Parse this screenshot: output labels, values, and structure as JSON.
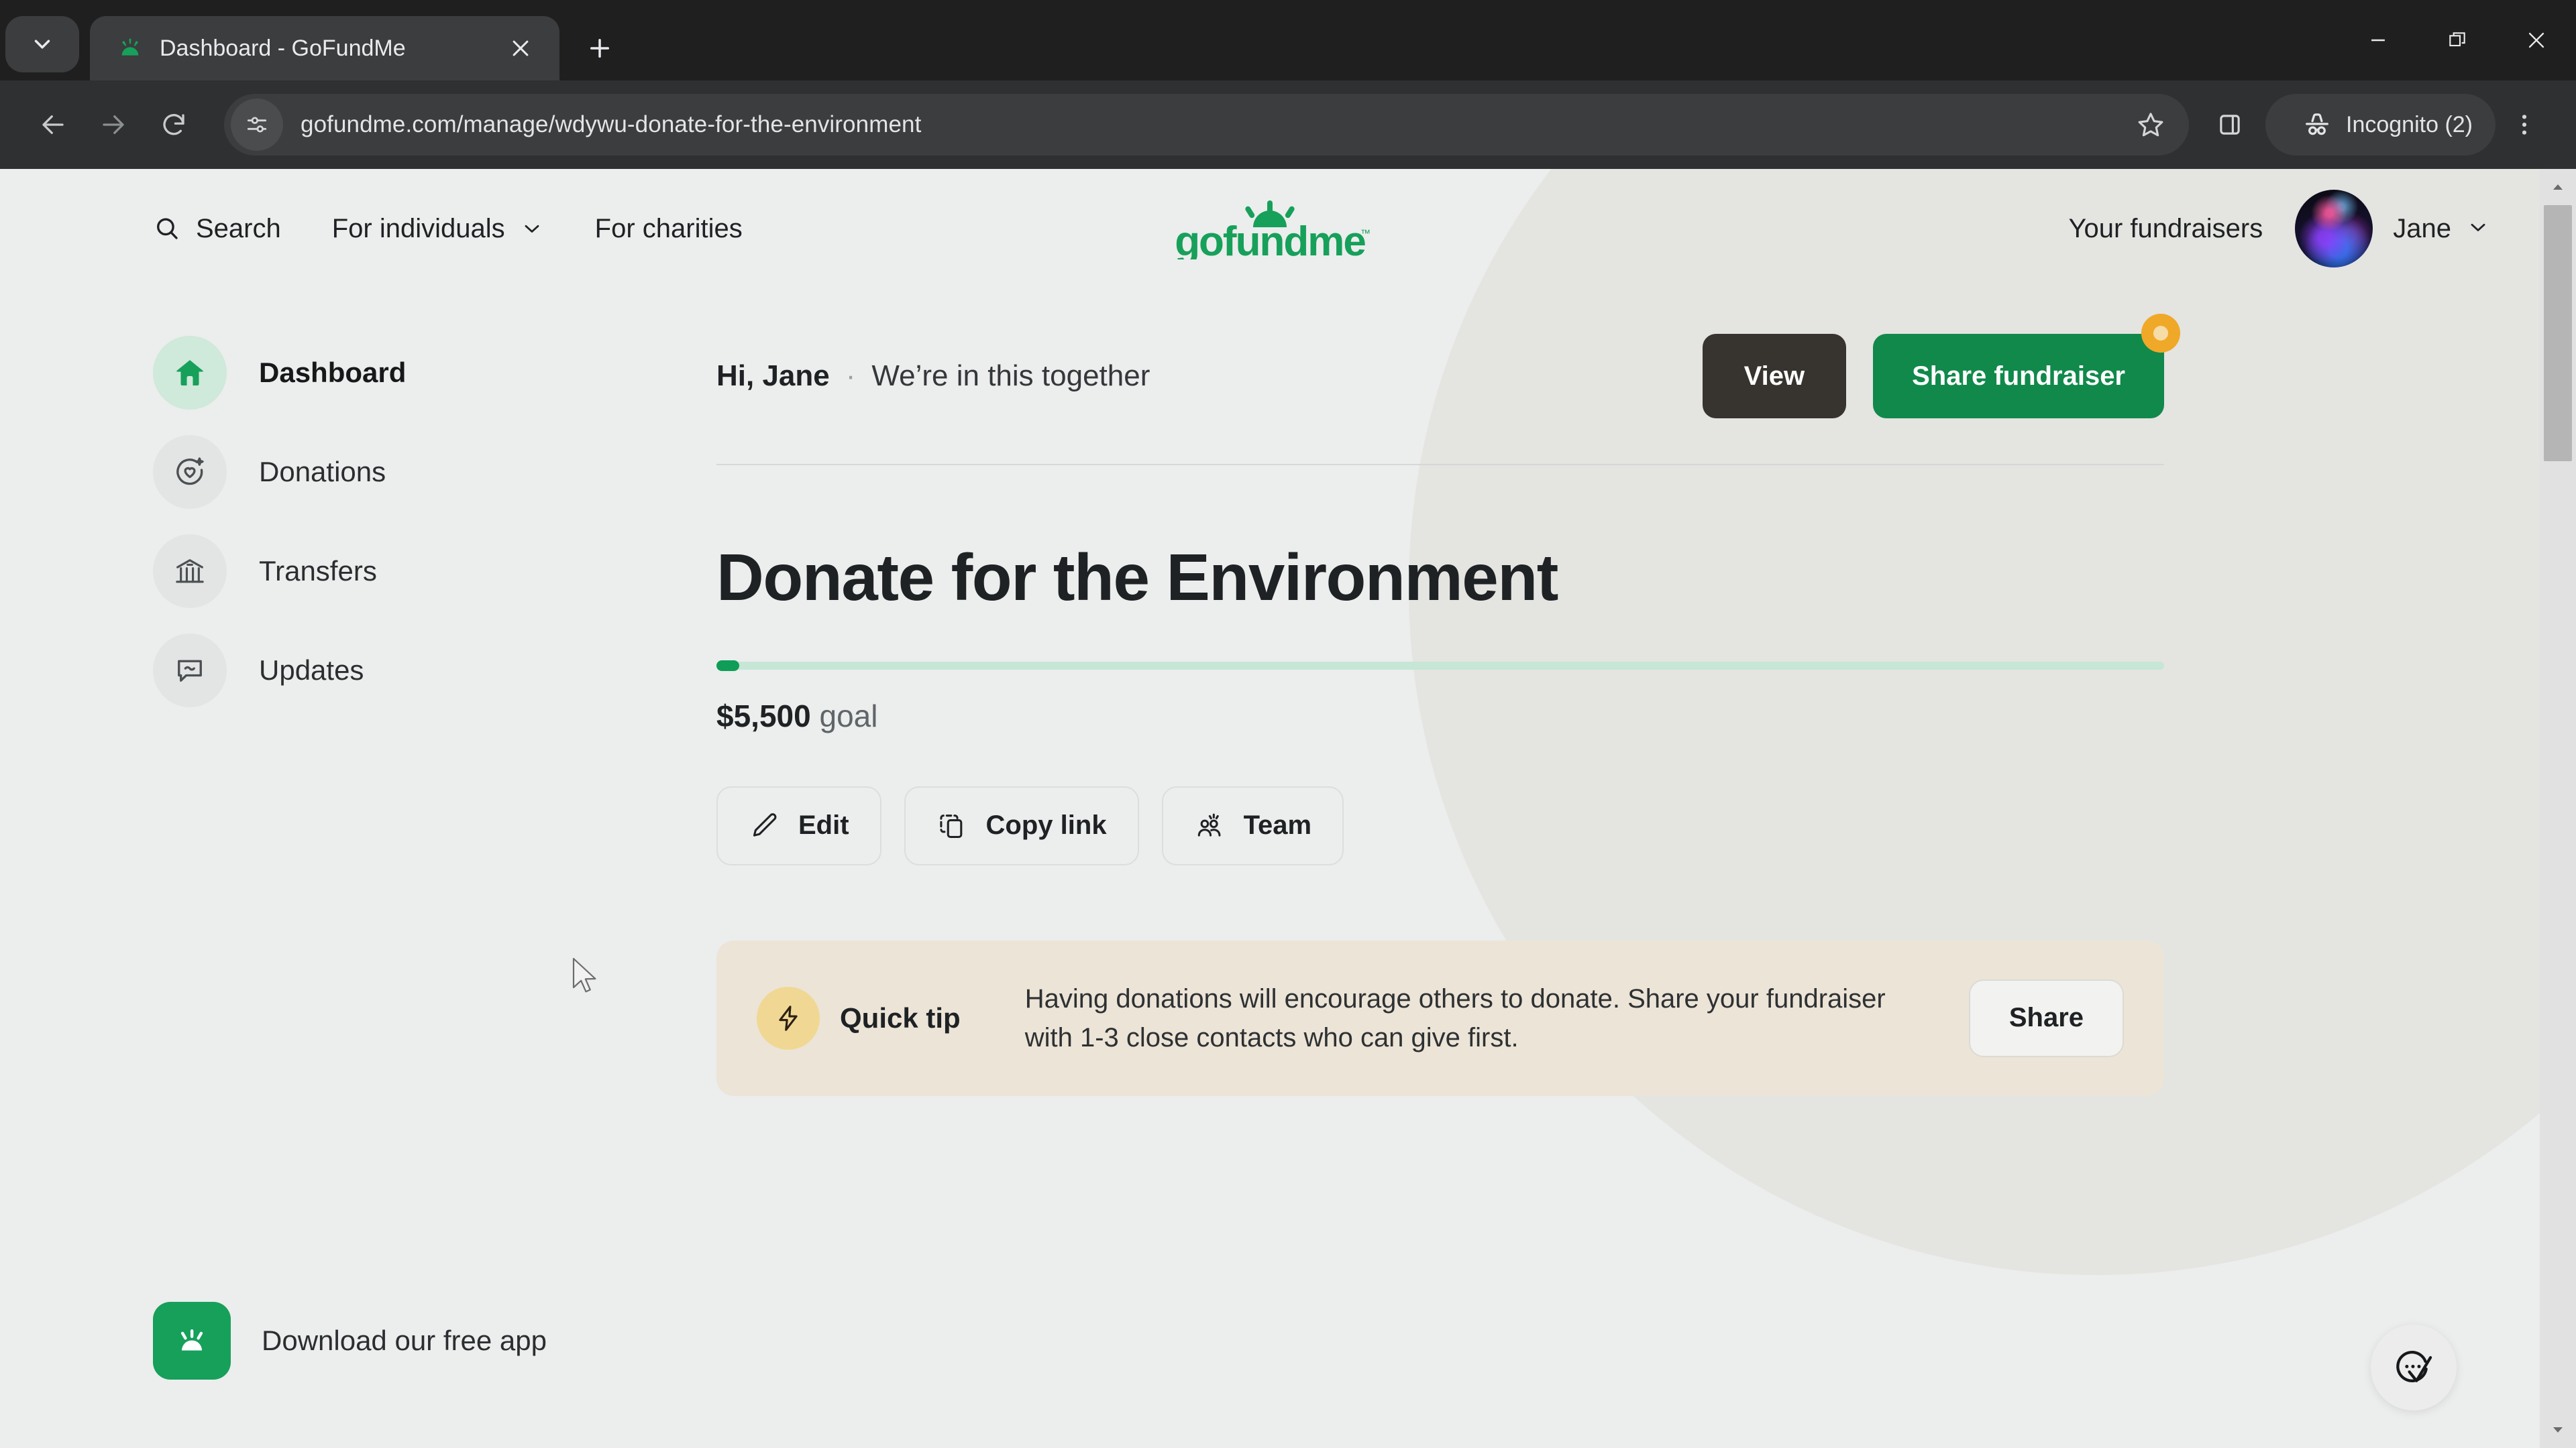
{
  "browser": {
    "tab": {
      "title": "Dashboard - GoFundMe",
      "favicon_icon": "gofundme-flame-icon",
      "close_icon": "close-icon"
    },
    "tab_search_icon": "chevron-down-icon",
    "new_tab_icon": "plus-icon",
    "window_controls": {
      "minimize_icon": "minimize-icon",
      "maximize_icon": "restore-icon",
      "close_icon": "close-icon"
    },
    "toolbar": {
      "back_icon": "back-arrow-icon",
      "forward_icon": "forward-arrow-icon",
      "reload_icon": "reload-icon",
      "site_info_icon": "tune-settings-icon",
      "url": "gofundme.com/manage/wdywu-donate-for-the-environment",
      "bookmark_icon": "star-icon",
      "side_panel_icon": "side-panel-icon",
      "profile_label": "Incognito (2)",
      "profile_icon": "incognito-hat-icon",
      "menu_icon": "three-dots-vertical-icon"
    }
  },
  "site_header": {
    "search_label": "Search",
    "search_icon": "search-icon",
    "for_individuals_label": "For individuals",
    "for_individuals_caret": "chevron-down-icon",
    "for_charities_label": "For charities",
    "logo_text": "gofundme",
    "logo_icon": "gofundme-sunrise-logo",
    "your_fundraisers_label": "Your fundraisers",
    "avatar_icon": "user-avatar",
    "username": "Jane",
    "username_caret": "chevron-down-icon"
  },
  "sidebar": {
    "items": [
      {
        "label": "Dashboard",
        "icon": "home-icon",
        "active": true
      },
      {
        "label": "Donations",
        "icon": "donation-heart-icon",
        "active": false
      },
      {
        "label": "Transfers",
        "icon": "bank-icon",
        "active": false
      },
      {
        "label": "Updates",
        "icon": "speech-bubble-icon",
        "active": false
      }
    ],
    "download_app": {
      "label": "Download our free app",
      "icon": "gofundme-app-icon"
    }
  },
  "main": {
    "greeting_hi": "Hi, Jane",
    "greeting_separator": "·",
    "greeting_subtitle": "We’re in this together",
    "view_button": "View",
    "share_fundraiser_button": "Share fundraiser",
    "share_badge_icon": "notification-dot",
    "campaign_title": "Donate for the Environment",
    "goal_amount": "$5,500",
    "goal_suffix": "goal",
    "progress_percent": 1,
    "actions": [
      {
        "label": "Edit",
        "icon": "pencil-icon"
      },
      {
        "label": "Copy link",
        "icon": "copy-icon"
      },
      {
        "label": "Team",
        "icon": "team-people-icon"
      }
    ],
    "quick_tip": {
      "label": "Quick tip",
      "icon": "lightning-bolt-icon",
      "text": "Having donations will encourage others to donate. Share your fundraiser with 1-3 close contacts who can give first.",
      "button": "Share"
    }
  },
  "chat_widget": {
    "icon": "chat-check-icon"
  },
  "scrollbar": {
    "up_icon": "caret-up-icon",
    "down_icon": "caret-down-icon"
  },
  "colors": {
    "brand_green": "#10894b",
    "page_bg": "#eceded",
    "tip_bg": "#ece4d7",
    "badge_orange": "#f0a829",
    "dark_button": "#37342f"
  }
}
